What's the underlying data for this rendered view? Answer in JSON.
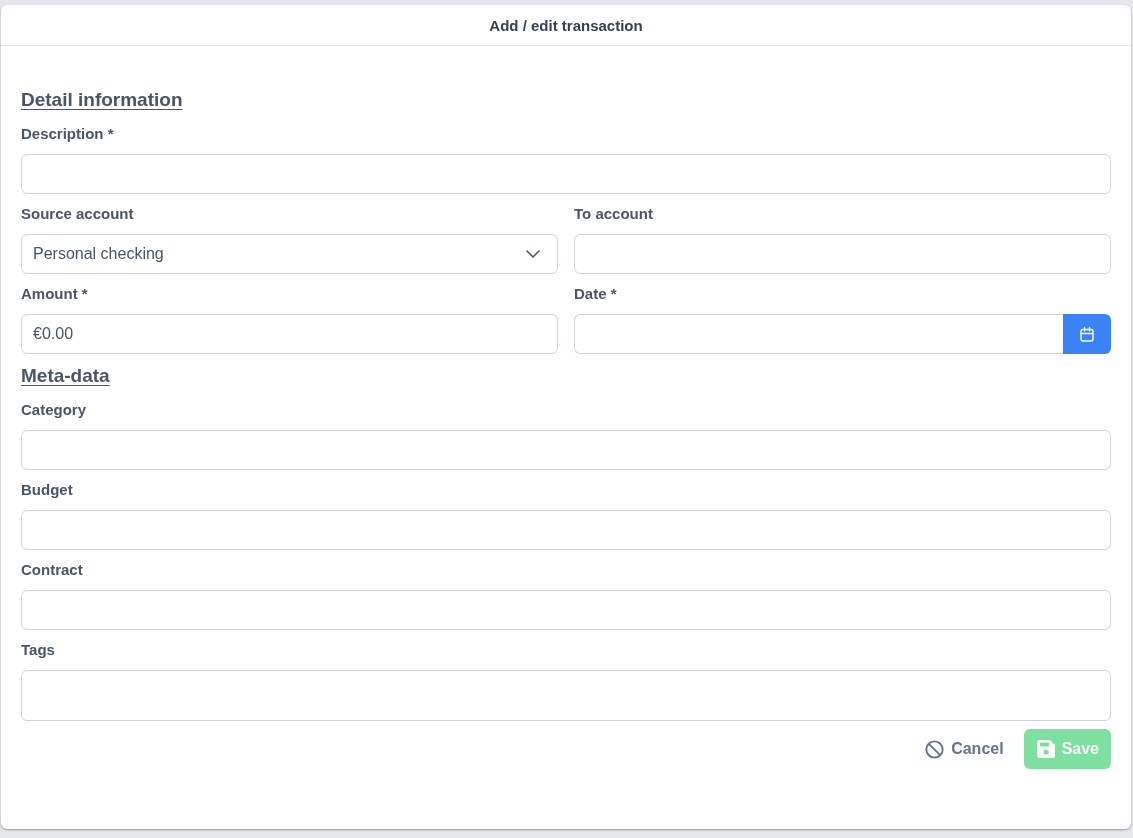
{
  "dialog": {
    "title": "Add / edit transaction"
  },
  "sections": [
    {
      "heading": "Detail information",
      "rows": [
        [
          {
            "kind": "text",
            "label": "Description *"
          }
        ],
        [
          {
            "kind": "select",
            "label": "Source account",
            "value": "Personal checking"
          },
          {
            "kind": "text",
            "label": "To account"
          }
        ],
        [
          {
            "kind": "text",
            "label": "Amount *",
            "value": "€0.00"
          },
          {
            "kind": "date",
            "label": "Date *"
          }
        ]
      ]
    },
    {
      "heading": "Meta-data",
      "rows": [
        [
          {
            "kind": "text",
            "label": "Category"
          }
        ],
        [
          {
            "kind": "text",
            "label": "Budget"
          }
        ],
        [
          {
            "kind": "text",
            "label": "Contract"
          }
        ],
        [
          {
            "kind": "tags",
            "label": "Tags"
          }
        ]
      ]
    }
  ],
  "actions": [
    {
      "kind": "cancel",
      "label": "Cancel",
      "disabled": false
    },
    {
      "kind": "save",
      "label": "Save",
      "disabled": true
    }
  ]
}
